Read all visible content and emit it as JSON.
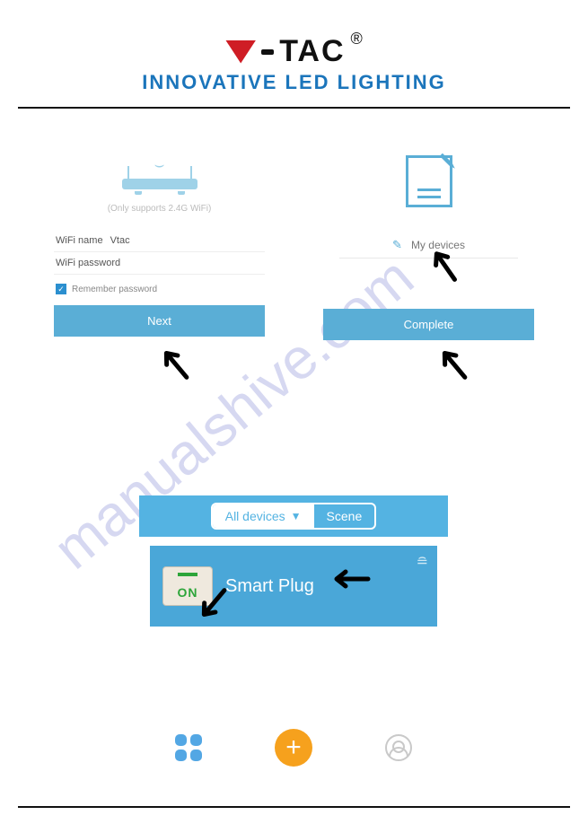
{
  "header": {
    "brand_suffix": "TAC",
    "tagline": "INNOVATIVE LED LIGHTING",
    "registered": "®"
  },
  "watermark": "manualshive.com",
  "wifi_panel": {
    "support_note": "(Only supports 2.4G WiFi)",
    "name_label": "WiFi name",
    "name_value": "Vtac",
    "password_label": "WiFi password",
    "remember_label": "Remember password",
    "next_button": "Next"
  },
  "device_panel": {
    "device_name": "My devices",
    "complete_button": "Complete"
  },
  "app": {
    "tab_all": "All devices",
    "tab_scene": "Scene",
    "card_title": "Smart Plug",
    "switch_state": "ON"
  }
}
